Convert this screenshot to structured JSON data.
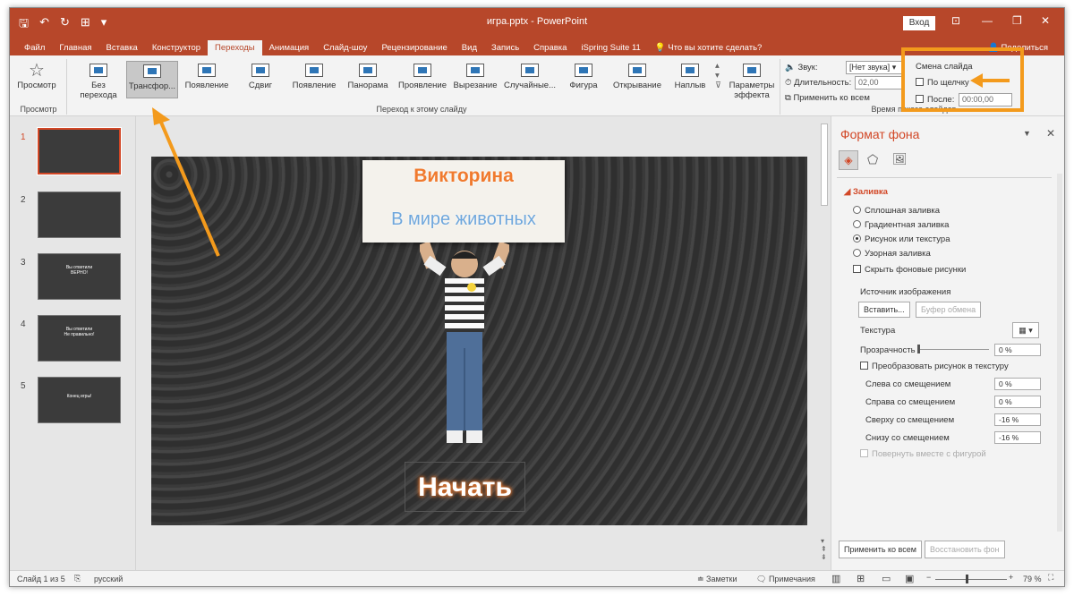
{
  "window": {
    "doc_title": "игра.pptx  -  PowerPoint",
    "login_label": "Вход"
  },
  "tabs": [
    "Файл",
    "Главная",
    "Вставка",
    "Конструктор",
    "Переходы",
    "Анимация",
    "Слайд-шоу",
    "Рецензирование",
    "Вид",
    "Запись",
    "Справка",
    "iSpring Suite 11"
  ],
  "tell_me": "Что вы хотите сделать?",
  "share_label": "Поделиться",
  "ribbon": {
    "preview_label": "Просмотр",
    "preview_group": "Просмотр",
    "transitions_group": "Переход к этому слайду",
    "timing_group": "Время показа слайдов",
    "transitions": [
      "Без перехода",
      "Трансфор...",
      "Появление",
      "Сдвиг",
      "Появление",
      "Панорама",
      "Проявление",
      "Вырезание",
      "Случайные...",
      "Фигура",
      "Открывание",
      "Наплыв"
    ],
    "effect_params": "Параметры эффекта",
    "sound_label": "Звук:",
    "sound_value": "[Нет звука]",
    "duration_label": "Длительность:",
    "duration_value": "02,00",
    "apply_all": "Применить ко всем",
    "advance_title": "Смена слайда",
    "on_click": "По щелчку",
    "after_label": "После:",
    "after_value": "00:00,00"
  },
  "thumbnails": [
    {
      "num": "1"
    },
    {
      "num": "2"
    },
    {
      "num": "3",
      "text": "Вы ответили\nВЕРНО!"
    },
    {
      "num": "4",
      "text": "Вы ответили\nНе правильно!"
    },
    {
      "num": "5",
      "text": "Конец игры!"
    }
  ],
  "slide": {
    "title": "Викторина",
    "subtitle": "В мире животных",
    "button": "Начать"
  },
  "pane": {
    "title": "Формат фона",
    "section": "Заливка",
    "fill_options": [
      "Сплошная заливка",
      "Градиентная заливка",
      "Рисунок или текстура",
      "Узорная заливка"
    ],
    "hide_bg": "Скрыть фоновые рисунки",
    "image_source": "Источник изображения",
    "insert_btn": "Вставить...",
    "clipboard_btn": "Буфер обмена",
    "texture": "Текстура",
    "transparency": "Прозрачность",
    "transparency_value": "0 %",
    "tile_picture": "Преобразовать рисунок в текстуру",
    "offsets": [
      {
        "label": "Слева со смещением",
        "value": "0 %"
      },
      {
        "label": "Справа со смещением",
        "value": "0 %"
      },
      {
        "label": "Сверху со смещением",
        "value": "-16 %"
      },
      {
        "label": "Снизу со смещением",
        "value": "-16 %"
      }
    ],
    "rotate_with": "Повернуть вместе с фигурой",
    "apply_all": "Применить ко всем",
    "reset": "Восстановить фон"
  },
  "status": {
    "slide_info": "Слайд 1 из 5",
    "language": "русский",
    "notes": "Заметки",
    "comments": "Примечания",
    "zoom": "79 %"
  }
}
